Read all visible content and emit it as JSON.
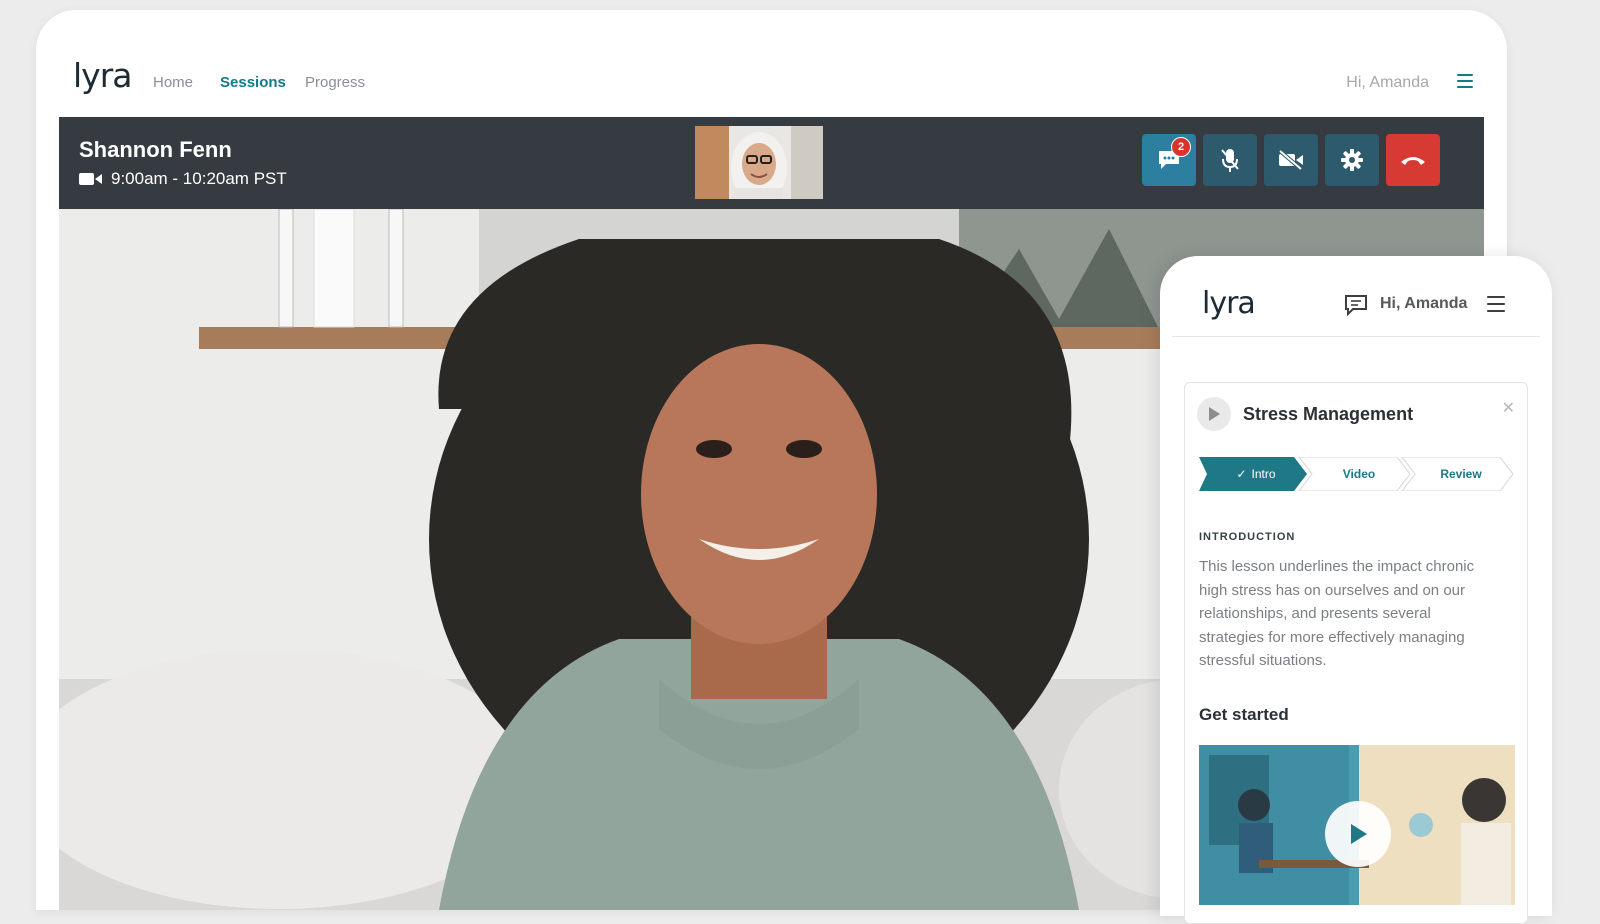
{
  "desktop": {
    "logo": "lyra",
    "nav": {
      "home": "Home",
      "sessions": "Sessions",
      "progress": "Progress"
    },
    "greeting": "Hi, Amanda",
    "menu_icon": "hamburger-menu-icon"
  },
  "call": {
    "name": "Shannon Fenn",
    "time": "9:00am - 10:20am PST",
    "chat_badge": "2",
    "controls": [
      "chat-icon",
      "microphone-off-icon",
      "video-off-icon",
      "gear-icon",
      "hang-up-icon"
    ]
  },
  "mobile": {
    "logo": "lyra",
    "greeting": "Hi, Amanda",
    "lesson": {
      "title": "Stress Management",
      "steps": [
        "Intro",
        "Video",
        "Review"
      ],
      "active_step": "Intro",
      "section_label": "INTRODUCTION",
      "description": "This lesson underlines the impact chronic high stress has on ourselves and on our relationships, and presents several strategies for more effectively managing stressful situations.",
      "get_started": "Get started"
    }
  },
  "colors": {
    "accent": "#117b86",
    "call_bar": "#353b40",
    "control_button": "#2d5a6c",
    "end_call": "#d63a33"
  }
}
